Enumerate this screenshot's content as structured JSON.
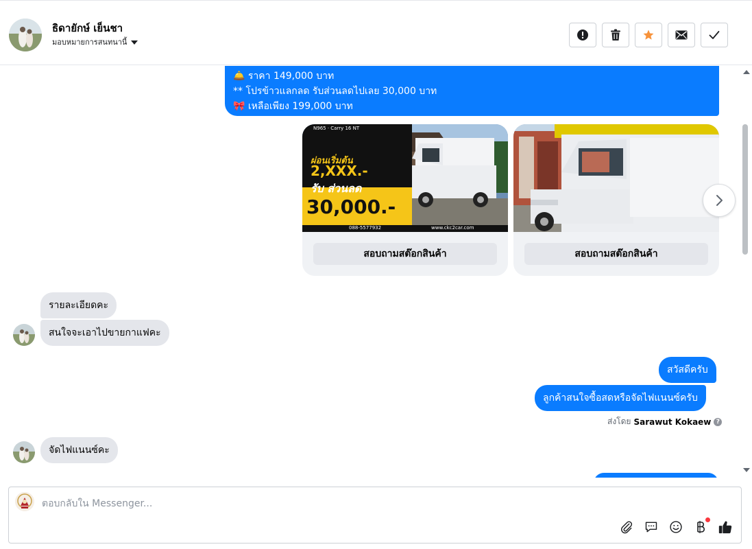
{
  "header": {
    "name": "ธิดายักษ์ เย็นชา",
    "assign_label": "มอบหมายการสนทนานี้",
    "actions": [
      {
        "name": "report-icon"
      },
      {
        "name": "trash-icon"
      },
      {
        "name": "star-icon"
      },
      {
        "name": "envelope-icon"
      },
      {
        "name": "check-icon"
      }
    ]
  },
  "messages": {
    "promo": {
      "line1": "🛎️  ราคา 149,000 บาท",
      "line2": "** โปรข้าวแลกลด รับส่วนลดไปเลย 30,000 บาท",
      "line3": "🎀 เหลือเพียง 199,000 บาท"
    },
    "cards": [
      {
        "button": "สอบถามสต๊อกสินค้า",
        "ad_lines": [
          "ผ่อนเริ่มต้น",
          "2,XXX.-",
          "รับ ส่วนลด",
          "30,000.-",
          "088-5577932",
          "www.ckc2car.com",
          "N965 · Carry 16 NT"
        ]
      },
      {
        "button": "สอบถามสต๊อกสินค้า"
      }
    ],
    "incoming_1": "รายละเอียดคะ",
    "incoming_2": "สนใจจะเอาไปขายกาแฟคะ",
    "outgoing_1": "สวัสดีครับ",
    "outgoing_2": "ลูกค้าสนใจซื้อสดหรือจัดไฟแนนซ์ครับ",
    "sent_by_prefix": "ส่งโดย",
    "sent_by_name": "Sarawut Kokaew",
    "incoming_3": "จัดไฟแนนซ์คะ"
  },
  "composer": {
    "placeholder": "ตอบกลับใน Messenger...",
    "tools": [
      "paperclip-icon",
      "speech-bubble-icon",
      "emoji-icon",
      "baht-icon",
      "thumbs-up-icon"
    ]
  },
  "colors": {
    "accent": "#0a7cff",
    "incoming_bg": "#e4e6eb",
    "star": "#f7923a"
  }
}
